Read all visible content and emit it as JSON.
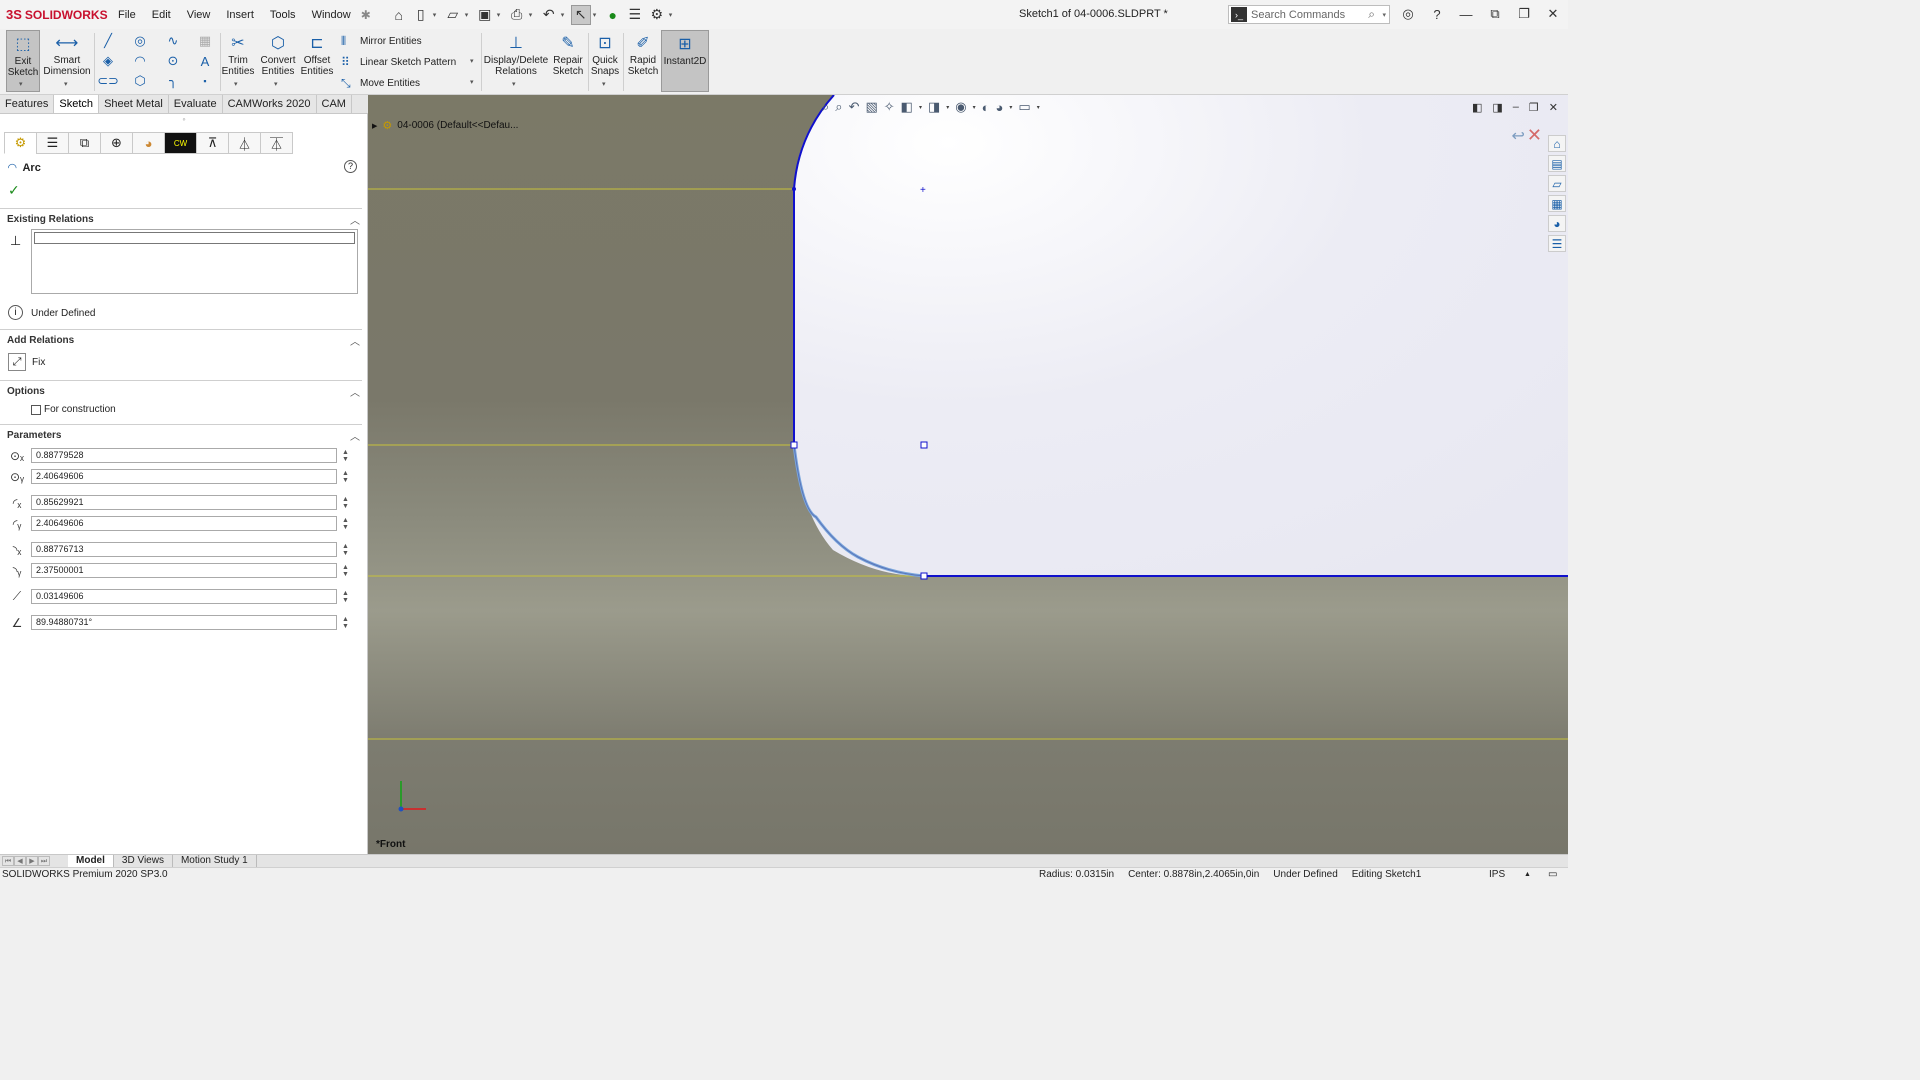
{
  "app": {
    "brand": "SOLIDWORKS",
    "doc_title": "Sketch1 of 04-0006.SLDPRT *"
  },
  "menu": [
    "File",
    "Edit",
    "View",
    "Insert",
    "Tools",
    "Window"
  ],
  "search": {
    "placeholder": "Search Commands"
  },
  "ribbon": {
    "exit_sketch": "Exit Sketch",
    "smart_dimension": "Smart Dimension",
    "trim_entities": "Trim Entities",
    "convert_entities": "Convert Entities",
    "offset_entities": "Offset Entities",
    "mirror_entities": "Mirror Entities",
    "linear_sketch_pattern": "Linear Sketch Pattern",
    "move_entities": "Move Entities",
    "display_delete_relations": "Display/Delete Relations",
    "repair_sketch": "Repair Sketch",
    "quick_snaps": "Quick Snaps",
    "rapid_sketch": "Rapid Sketch",
    "instant2d": "Instant2D"
  },
  "tabs": [
    "Features",
    "Sketch",
    "Sheet Metal",
    "Evaluate",
    "CAMWorks 2020",
    "CAM"
  ],
  "active_tab": "Sketch",
  "property_manager": {
    "title": "Arc",
    "existing_relations": {
      "title": "Existing Relations",
      "status": "Under Defined"
    },
    "add_relations": {
      "title": "Add Relations",
      "fix": "Fix"
    },
    "options": {
      "title": "Options",
      "for_construction": "For construction",
      "for_construction_checked": false
    },
    "parameters": {
      "title": "Parameters",
      "center_x": "0.88779528",
      "center_y": "2.40649606",
      "start_x": "0.85629921",
      "start_y": "2.40649606",
      "end_x": "0.88776713",
      "end_y": "2.37500001",
      "radius": "0.03149606",
      "angle": "89.94880731°"
    }
  },
  "viewport": {
    "tree_item": "04-0006  (Default<<Defau...",
    "view_label": "*Front"
  },
  "bottom_tabs": [
    "Model",
    "3D Views",
    "Motion Study 1"
  ],
  "active_bottom_tab": "Model",
  "status_bar": {
    "product": "SOLIDWORKS Premium 2020 SP3.0",
    "radius": "Radius: 0.0315in",
    "center": "Center: 0.8878in,2.4065in,0in",
    "definition": "Under Defined",
    "editing": "Editing Sketch1",
    "units": "IPS"
  },
  "colors": {
    "sketch_line": "#1010cc",
    "accent": "#c8102e",
    "viewport_bg": "#7b7967"
  }
}
